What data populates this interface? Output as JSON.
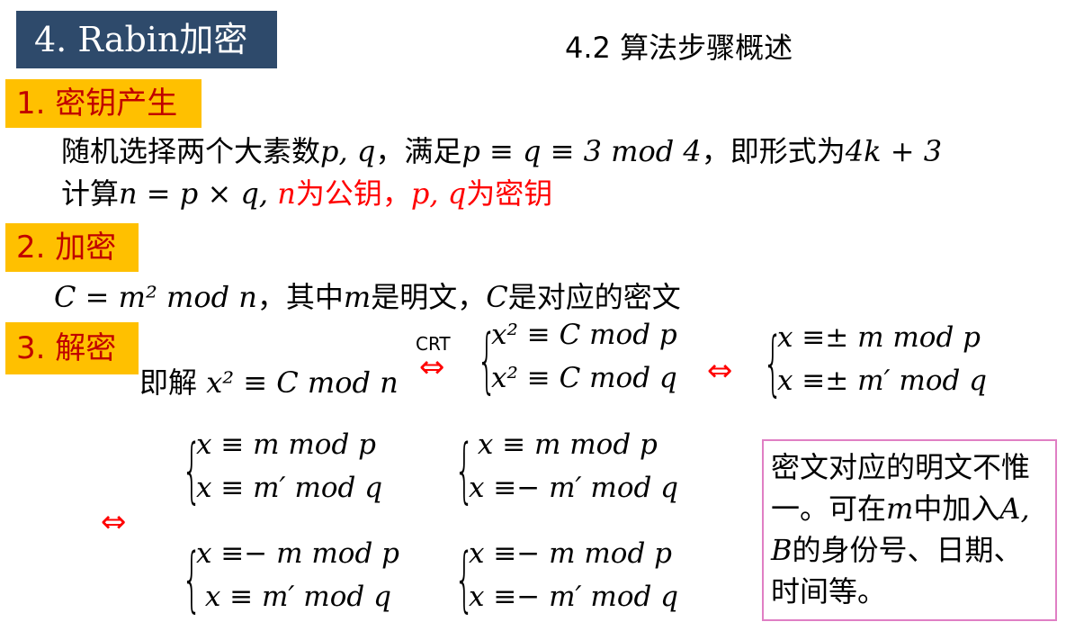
{
  "header": {
    "title": "4. Rabin加密",
    "subtitle": "4.2 算法步骤概述"
  },
  "sections": {
    "key_gen": {
      "tag": "1. 密钥产生",
      "line1_pre": "随机选择两个大素数",
      "line1_pq": "p, q",
      "line1_mid": "，满足",
      "line1_cond": "p ≡ q ≡ 3 mod 4",
      "line1_mid2": "，即形式为",
      "line1_form": "4k + 3",
      "line2_pre": "计算",
      "line2_eq": "n = p × q,",
      "line2_n": "n",
      "line2_pub": "为公钥，",
      "line2_pq": "p, q",
      "line2_priv": "为密钥"
    },
    "encrypt": {
      "tag": "2. 加密",
      "formula": "C = m² mod n",
      "mid": "，其中",
      "m": "m",
      "is_plain": "是明文，",
      "c": "C",
      "is_cipher": "是对应的密文"
    },
    "decrypt": {
      "tag": "3. 解密",
      "solve_pre": "即解",
      "solve_eq": "x² ≡ C mod n",
      "crt_label": "CRT",
      "arrow": "⇔",
      "crt_row1": "x² ≡ C mod p",
      "crt_row2": "x² ≡ C mod q",
      "pm_row1": "x ≡± m mod p",
      "pm_row2": "x ≡± m′ mod q",
      "sys_a_row1": "x ≡ m mod p",
      "sys_a_row2": "x ≡ m′ mod q",
      "sys_b_row1": " x ≡ m mod p",
      "sys_b_row2": "x ≡− m′ mod q",
      "sys_c_row1": "x ≡− m mod p",
      "sys_c_row2": " x ≡ m′ mod q",
      "sys_d_row1": "x ≡− m mod p",
      "sys_d_row2": "x ≡− m′ mod q"
    }
  },
  "note": {
    "p1": "密文对应的明文不惟一。可在",
    "m": "m",
    "p2": "中加入",
    "ab": "A, B",
    "p3": "的身份号、日期、时间等。"
  },
  "colors": {
    "title_bg": "#2e4a6b",
    "tag_bg": "#ffc000",
    "tag_text": "#c00000",
    "highlight": "#ff0000",
    "note_border": "#e07fc4"
  }
}
